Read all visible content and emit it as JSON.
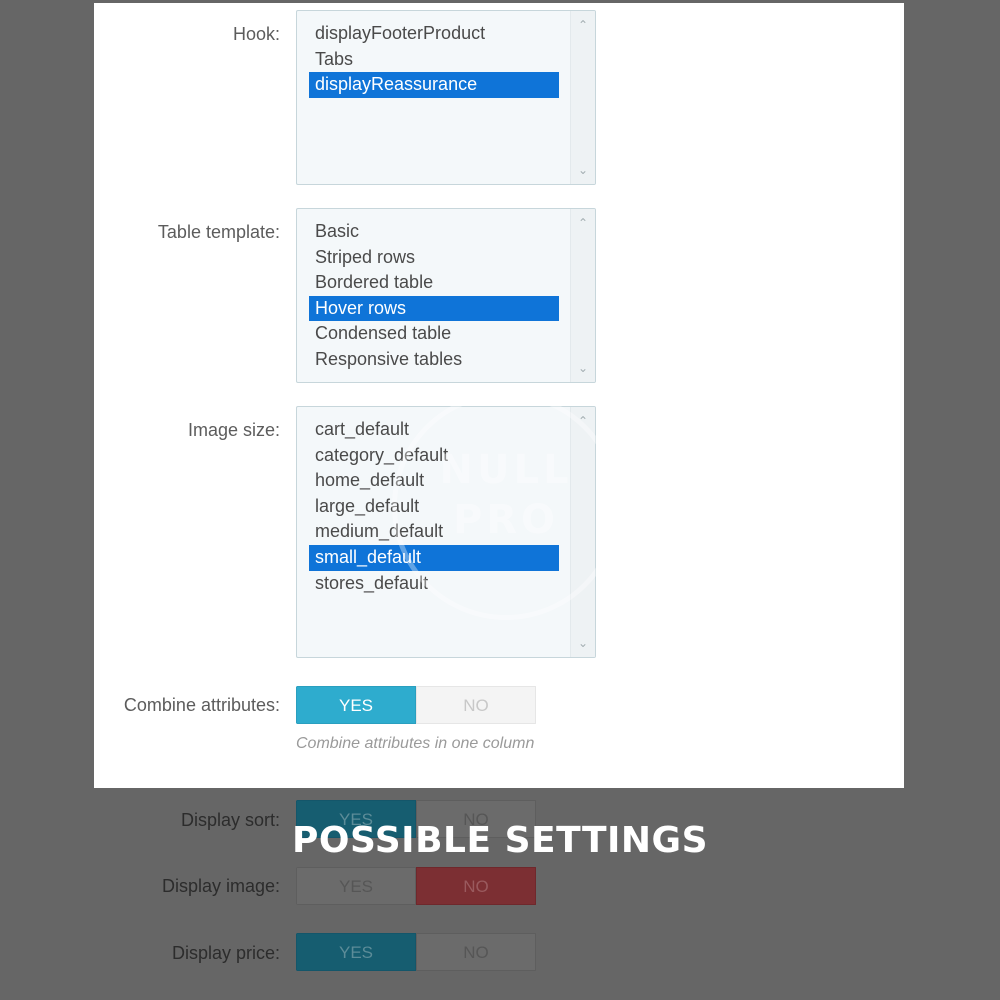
{
  "hook": {
    "label": "Hook:",
    "options": [
      "displayFooterProduct",
      "Tabs",
      "displayReassurance"
    ],
    "selected": "displayReassurance"
  },
  "table_template": {
    "label": "Table template:",
    "options": [
      "Basic",
      "Striped rows",
      "Bordered table",
      "Hover rows",
      "Condensed table",
      "Responsive tables"
    ],
    "selected": "Hover rows"
  },
  "image_size": {
    "label": "Image size:",
    "options": [
      "cart_default",
      "category_default",
      "home_default",
      "large_default",
      "medium_default",
      "small_default",
      "stores_default"
    ],
    "selected": "small_default"
  },
  "combine_attributes": {
    "label": "Combine attributes:",
    "yes": "YES",
    "no": "NO",
    "value": "YES",
    "help": "Combine attributes in one column"
  },
  "display_sort": {
    "label": "Display sort:",
    "yes": "YES",
    "no": "NO",
    "value": "YES"
  },
  "display_image": {
    "label": "Display image:",
    "yes": "YES",
    "no": "NO",
    "value": "NO"
  },
  "display_price": {
    "label": "Display price:",
    "yes": "YES",
    "no": "NO",
    "value": "YES"
  },
  "banner": {
    "text": "POSSIBLE SETTINGS"
  },
  "watermark": {
    "line1": "NULL",
    "line2": "PRO"
  },
  "colors": {
    "selected_option": "#0f74d8",
    "toggle_yes_active": "#2eacce",
    "toggle_no_active": "#7c2f33",
    "overlay": "#666666"
  }
}
